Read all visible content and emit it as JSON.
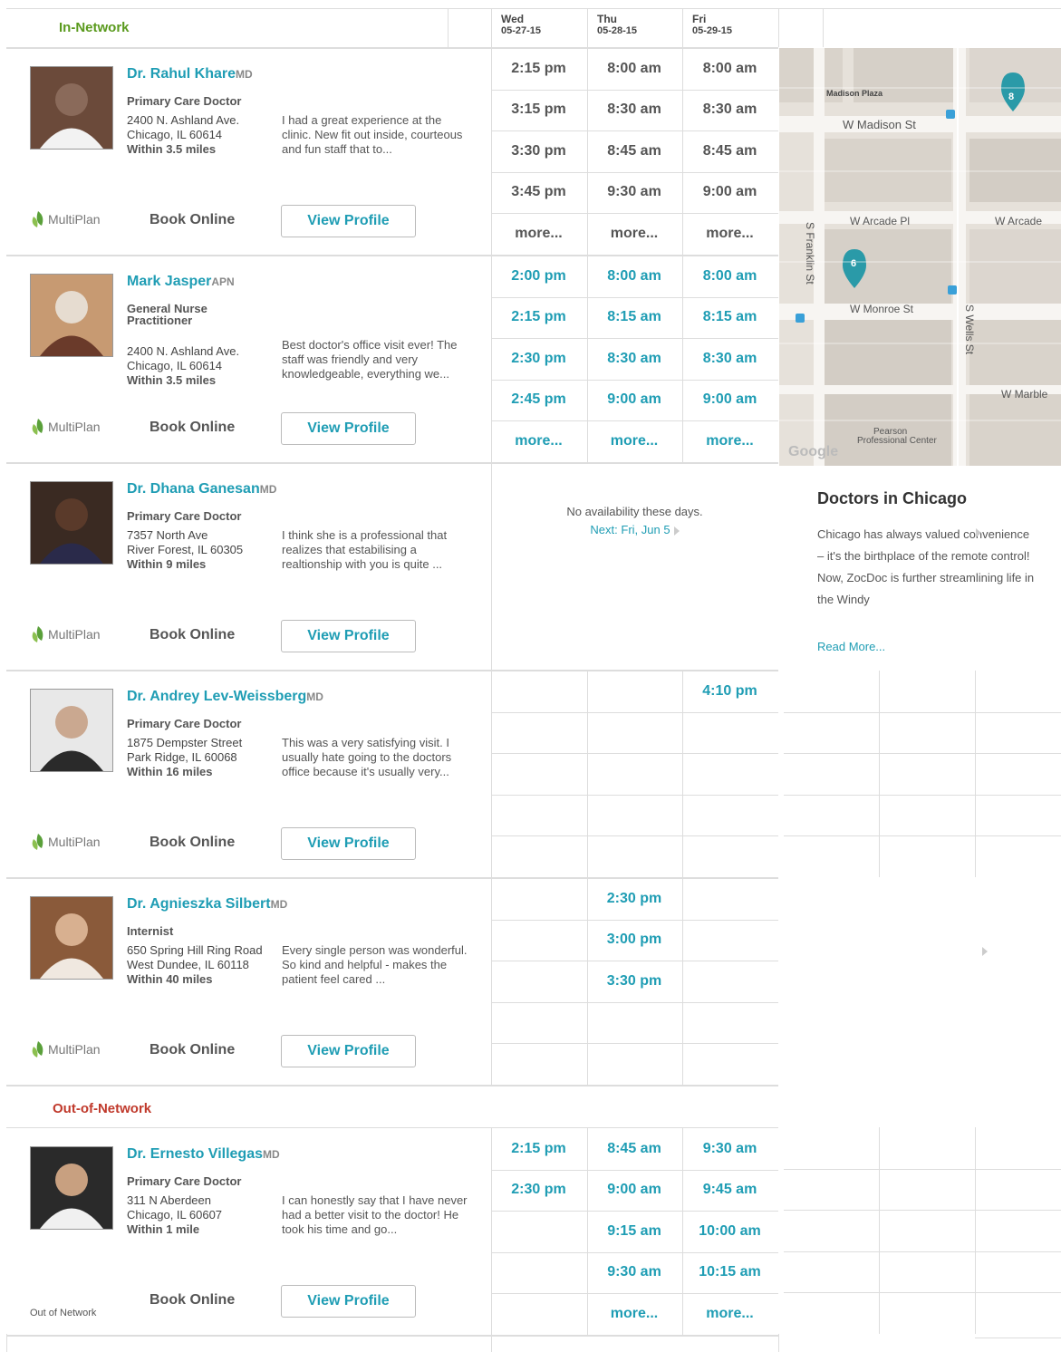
{
  "header": {
    "in_network_label": "In-Network",
    "days": [
      {
        "day": "Wed",
        "date": "05-27-15"
      },
      {
        "day": "Thu",
        "date": "05-28-15"
      },
      {
        "day": "Fri",
        "date": "05-29-15"
      }
    ]
  },
  "doctors": [
    {
      "name": "Dr. Rahul Khare",
      "cred": "MD",
      "specialty": "Primary Care Doctor",
      "addr1": "2400 N. Ashland Ave.",
      "addr2": "Chicago, IL 60614",
      "distance": "Within 3.5 miles",
      "review": "I had a great experience at the clinic. New fit out inside, courteous and fun staff that to...",
      "insurance": "MultiPlan",
      "book": "Book Online",
      "view": "View Profile",
      "slots": [
        [
          "2:15 pm",
          "8:00 am",
          "8:00 am"
        ],
        [
          "3:15 pm",
          "8:30 am",
          "8:30 am"
        ],
        [
          "3:30 pm",
          "8:45 am",
          "8:45 am"
        ],
        [
          "3:45 pm",
          "9:30 am",
          "9:00 am"
        ],
        [
          "more...",
          "more...",
          "more..."
        ]
      ],
      "slot_color": "gray"
    },
    {
      "name": "Mark Jasper",
      "cred": "APN",
      "specialty": "General Nurse Practitioner",
      "addr1": "2400 N. Ashland Ave.",
      "addr2": "Chicago, IL 60614",
      "distance": "Within 3.5 miles",
      "review": "Best doctor's office visit ever! The staff was friendly and very knowledgeable, everything we...",
      "insurance": "MultiPlan",
      "book": "Book Online",
      "view": "View Profile",
      "slots": [
        [
          "2:00 pm",
          "8:00 am",
          "8:00 am"
        ],
        [
          "2:15 pm",
          "8:15 am",
          "8:15 am"
        ],
        [
          "2:30 pm",
          "8:30 am",
          "8:30 am"
        ],
        [
          "2:45 pm",
          "9:00 am",
          "9:00 am"
        ],
        [
          "more...",
          "more...",
          "more..."
        ]
      ],
      "slot_color": "teal"
    },
    {
      "name": "Dr. Dhana Ganesan",
      "cred": "MD",
      "specialty": "Primary Care Doctor",
      "addr1": "7357 North Ave",
      "addr2": "River Forest, IL 60305",
      "distance": "Within 9 miles",
      "review": "I think she is a professional that realizes that estabilising a realtionship with you is quite ...",
      "insurance": "MultiPlan",
      "book": "Book Online",
      "view": "View Profile",
      "no_availability": "No availability these days.",
      "next": "Next: Fri, Jun 5"
    },
    {
      "name": "Dr. Andrey Lev-Weissberg",
      "cred": "MD",
      "specialty": "Primary Care Doctor",
      "addr1": "1875 Dempster Street",
      "addr2": "Park Ridge, IL 60068",
      "distance": "Within 16 miles",
      "review": "This was a very satisfying visit. I usually hate going to the doctors office because it's usually very...",
      "insurance": "MultiPlan",
      "book": "Book Online",
      "view": "View Profile",
      "slots": [
        [
          "",
          "",
          "4:10 pm"
        ],
        [
          "",
          "",
          ""
        ],
        [
          "",
          "",
          ""
        ],
        [
          "",
          "",
          ""
        ],
        [
          "",
          "",
          ""
        ]
      ],
      "slot_color": "teal"
    },
    {
      "name": "Dr. Agnieszka Silbert",
      "cred": "MD",
      "specialty": "Internist",
      "addr1": "650 Spring Hill Ring Road",
      "addr2": "West Dundee, IL 60118",
      "distance": "Within 40 miles",
      "review": "Every single person was wonderful. So kind and helpful - makes the patient feel cared ...",
      "insurance": "MultiPlan",
      "book": "Book Online",
      "view": "View Profile",
      "slots": [
        [
          "",
          "2:30 pm",
          ""
        ],
        [
          "",
          "3:00 pm",
          ""
        ],
        [
          "",
          "3:30 pm",
          ""
        ],
        [
          "",
          "",
          ""
        ],
        [
          "",
          "",
          ""
        ]
      ],
      "slot_color": "teal"
    },
    {
      "name": "Dr. Ernesto Villegas",
      "cred": "MD",
      "specialty": "Primary Care Doctor",
      "addr1": "311 N Aberdeen",
      "addr2": "Chicago, IL 60607",
      "distance": "Within 1 mile",
      "review": "I can honestly say that I have never had a better visit to the doctor! He took his time and go...",
      "out_of_network": "Out of Network",
      "book": "Book Online",
      "view": "View Profile",
      "slots": [
        [
          "2:15 pm",
          "8:45 am",
          "9:30 am"
        ],
        [
          "2:30 pm",
          "9:00 am",
          "9:45 am"
        ],
        [
          "",
          "9:15 am",
          "10:00 am"
        ],
        [
          "",
          "9:30 am",
          "10:15 am"
        ],
        [
          "",
          "more...",
          "more..."
        ]
      ],
      "slot_color": "teal"
    }
  ],
  "out_network_label": "Out-of-Network",
  "map": {
    "streets": [
      "Madison Plaza",
      "W Madison St",
      "W Arcade Pl",
      "W Arcade",
      "S Franklin St",
      "W Monroe St",
      "S Wells St",
      "W Marble",
      "Pearson Professional Center"
    ],
    "markers": [
      "8",
      "6"
    ],
    "attribution": "Google"
  },
  "sidebar": {
    "title": "Doctors in Chicago",
    "text": "Chicago has always valued convenience – it's the birthplace of the remote control! Now, ZocDoc is further streamlining life in the Windy",
    "read_more": "Read More..."
  },
  "colors": {
    "teal": "#1f9db4",
    "green": "#5a9a1d",
    "red": "#c0392b"
  }
}
